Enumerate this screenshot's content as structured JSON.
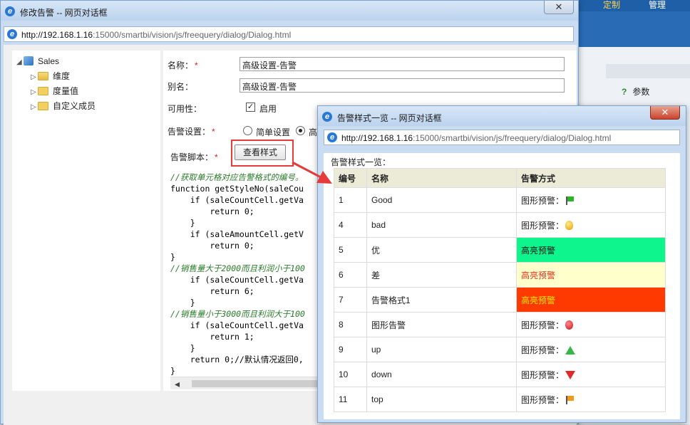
{
  "background_app": {
    "top_items": [
      "定制",
      "管理"
    ],
    "panel_item": "参数"
  },
  "dialog_edit": {
    "title": "修改告警 -- 网页对话框",
    "url_host": "http://192.168.1.16",
    "url_rest": ":15000/smartbi/vision/js/freequery/dialog/Dialog.html",
    "tree": {
      "root": "Sales",
      "children": [
        "维度",
        "度量值",
        "自定义成员"
      ]
    },
    "form": {
      "name_label": "名称：",
      "name_value": "高级设置-告警",
      "alias_label": "别名：",
      "alias_value": "高级设置-告警",
      "enabled_label": "可用性：",
      "enabled_text": "启用",
      "setting_label": "告警设置：",
      "radio_simple": "简单设置",
      "radio_advanced": "高",
      "script_label": "告警脚本：",
      "view_style_button": "查看样式"
    },
    "code_lines": [
      {
        "t": "c",
        "s": "//获取单元格对应告警格式的编号。"
      },
      {
        "t": "k",
        "s": "function getStyleNo(saleCou"
      },
      {
        "t": "k",
        "s": "    if (saleCountCell.getVa"
      },
      {
        "t": "k",
        "s": "        return 0;"
      },
      {
        "t": "n",
        "s": "    }"
      },
      {
        "t": "k",
        "s": "    if (saleAmountCell.getV"
      },
      {
        "t": "k",
        "s": "        return 0;"
      },
      {
        "t": "n",
        "s": "}"
      },
      {
        "t": "c",
        "s": "//销售量大于2000而且利润小于100"
      },
      {
        "t": "k",
        "s": "    if (saleCountCell.getVa"
      },
      {
        "t": "k",
        "s": "        return 6;"
      },
      {
        "t": "n",
        "s": "    }"
      },
      {
        "t": "c",
        "s": "//销售量小于3000而且利润大于100"
      },
      {
        "t": "k",
        "s": "    if (saleCountCell.getVa"
      },
      {
        "t": "k",
        "s": "        return 1;"
      },
      {
        "t": "n",
        "s": "    }"
      },
      {
        "t": "k",
        "s": "    return 0;//默认情况返回0,"
      },
      {
        "t": "n",
        "s": "}"
      }
    ]
  },
  "dialog_styles": {
    "title": "告警样式一览 -- 网页对话框",
    "url_host": "http://192.168.1.16",
    "url_rest": ":15000/smartbi/vision/js/freequery/dialog/Dialog.html",
    "list_title": "告警样式一览：",
    "columns": [
      "编号",
      "名称",
      "告警方式"
    ],
    "rows": [
      {
        "no": "1",
        "name": "Good",
        "mode": "图形预警：",
        "kind": "icon",
        "icon": "green-flag-icon"
      },
      {
        "no": "4",
        "name": "bad",
        "mode": "图形预警：",
        "kind": "icon",
        "icon": "lightbulb-icon"
      },
      {
        "no": "5",
        "name": "优",
        "mode": "高亮预警",
        "kind": "green"
      },
      {
        "no": "6",
        "name": "差",
        "mode": "高亮预警",
        "kind": "yellow"
      },
      {
        "no": "7",
        "name": "告警格式1",
        "mode": "高亮预警",
        "kind": "red"
      },
      {
        "no": "8",
        "name": "图形告警",
        "mode": "图形预警：",
        "kind": "icon",
        "icon": "red-pin-icon"
      },
      {
        "no": "9",
        "name": "up",
        "mode": "图形预警：",
        "kind": "icon",
        "icon": "up-arrow-icon"
      },
      {
        "no": "10",
        "name": "down",
        "mode": "图形预警：",
        "kind": "icon",
        "icon": "down-arrow-icon"
      },
      {
        "no": "11",
        "name": "top",
        "mode": "图形预警：",
        "kind": "icon",
        "icon": "orange-flag-icon"
      }
    ]
  },
  "colors": {
    "highlight_green": "#0ef58e",
    "highlight_yellow": "#ffffcc",
    "highlight_red": "#ff3a00",
    "annotation_red": "#e53b3b"
  }
}
